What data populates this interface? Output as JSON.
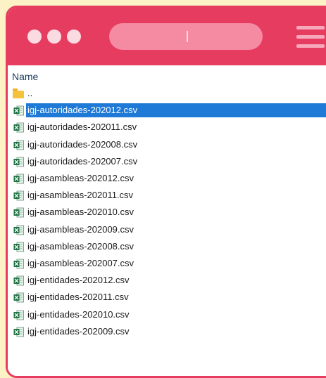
{
  "header": {
    "column_name": "Name"
  },
  "colors": {
    "accent": "#e63c5f",
    "selection": "#1e7ad6",
    "background": "#fdf2c6"
  },
  "files": [
    {
      "label": "..",
      "icon": "folder-icon",
      "selected": false
    },
    {
      "label": "igj-autoridades-202012.csv",
      "icon": "excel-csv-icon",
      "selected": true
    },
    {
      "label": "igj-autoridades-202011.csv",
      "icon": "excel-csv-icon",
      "selected": false
    },
    {
      "label": "igj-autoridades-202008.csv",
      "icon": "excel-csv-icon",
      "selected": false
    },
    {
      "label": "igj-autoridades-202007.csv",
      "icon": "excel-csv-icon",
      "selected": false
    },
    {
      "label": "igj-asambleas-202012.csv",
      "icon": "excel-csv-icon",
      "selected": false
    },
    {
      "label": "igj-asambleas-202011.csv",
      "icon": "excel-csv-icon",
      "selected": false
    },
    {
      "label": "igj-asambleas-202010.csv",
      "icon": "excel-csv-icon",
      "selected": false
    },
    {
      "label": "igj-asambleas-202009.csv",
      "icon": "excel-csv-icon",
      "selected": false
    },
    {
      "label": "igj-asambleas-202008.csv",
      "icon": "excel-csv-icon",
      "selected": false
    },
    {
      "label": "igj-asambleas-202007.csv",
      "icon": "excel-csv-icon",
      "selected": false
    },
    {
      "label": "igj-entidades-202012.csv",
      "icon": "excel-csv-icon",
      "selected": false
    },
    {
      "label": "igj-entidades-202011.csv",
      "icon": "excel-csv-icon",
      "selected": false
    },
    {
      "label": "igj-entidades-202010.csv",
      "icon": "excel-csv-icon",
      "selected": false
    },
    {
      "label": "igj-entidades-202009.csv",
      "icon": "excel-csv-icon",
      "selected": false
    }
  ]
}
